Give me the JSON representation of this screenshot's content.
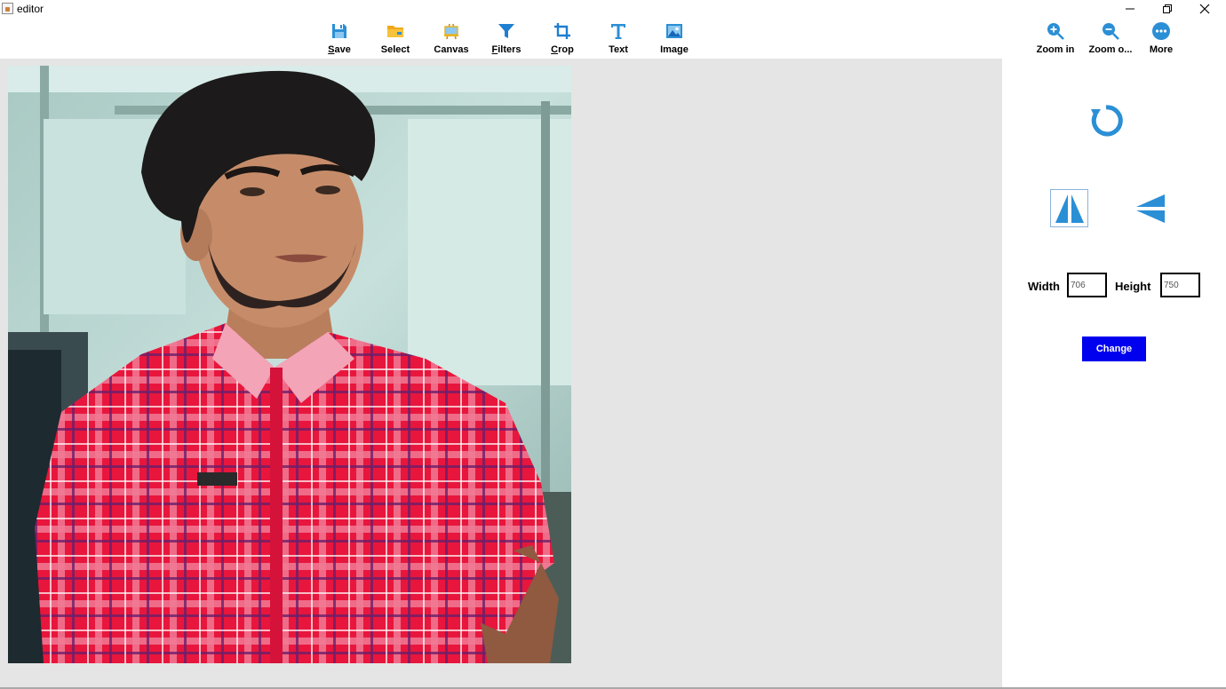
{
  "window": {
    "title": "editor"
  },
  "toolbar": {
    "save": "Save",
    "select": "Select",
    "canvas": "Canvas",
    "filters": "Filters",
    "crop": "Crop",
    "text": "Text",
    "image": "Image",
    "zoom_in": "Zoom in",
    "zoom_out": "Zoom o...",
    "more": "More"
  },
  "panel": {
    "width_label": "Width",
    "height_label": "Height",
    "width_value": "706",
    "height_value": "750",
    "change_label": "Change"
  },
  "icons": {
    "accent": "#2b8fd6",
    "accent_dark": "#1565b8",
    "folder": "#f0a818",
    "canvas": "#e8b320",
    "button_blue": "#0000ee"
  }
}
